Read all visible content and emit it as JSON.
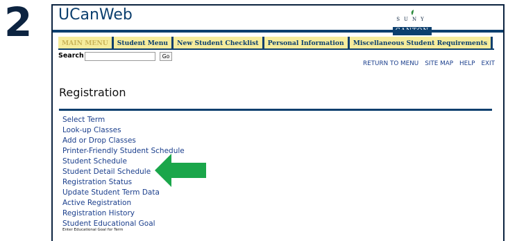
{
  "step_number": "2",
  "app": {
    "title": "UCanWeb"
  },
  "logo": {
    "suny_text": "SUNY",
    "canton_text": "CANTON"
  },
  "tabs": [
    {
      "label": "MAIN MENU"
    },
    {
      "label": "Student Menu"
    },
    {
      "label": "New Student Checklist"
    },
    {
      "label": "Personal Information"
    },
    {
      "label": "Miscellaneous Student Requirements"
    }
  ],
  "search": {
    "label": "Search",
    "value": "",
    "button_label": "Go"
  },
  "toplinks": [
    {
      "label": "RETURN TO MENU"
    },
    {
      "label": "SITE MAP"
    },
    {
      "label": "HELP"
    },
    {
      "label": "EXIT"
    }
  ],
  "page": {
    "title": "Registration"
  },
  "menu": {
    "items": [
      {
        "label": "Select Term"
      },
      {
        "label": "Look-up Classes"
      },
      {
        "label": "Add or Drop Classes"
      },
      {
        "label": "Printer-Friendly Student Schedule"
      },
      {
        "label": "Student Schedule"
      },
      {
        "label": "Student Detail Schedule"
      },
      {
        "label": "Registration Status"
      },
      {
        "label": "Update Student Term Data"
      },
      {
        "label": "Active Registration"
      },
      {
        "label": "Registration History"
      },
      {
        "label": "Student Educational Goal"
      }
    ],
    "last_item_description": "Enter Educational Goal for Term"
  },
  "colors": {
    "navy": "#0c3f6e",
    "link": "#1a3e8c",
    "tab_bg": "#f6ec9c",
    "arrow": "#1aa64a"
  },
  "callout": {
    "icon": "left-arrow-icon",
    "points_to": "Student Detail Schedule"
  }
}
